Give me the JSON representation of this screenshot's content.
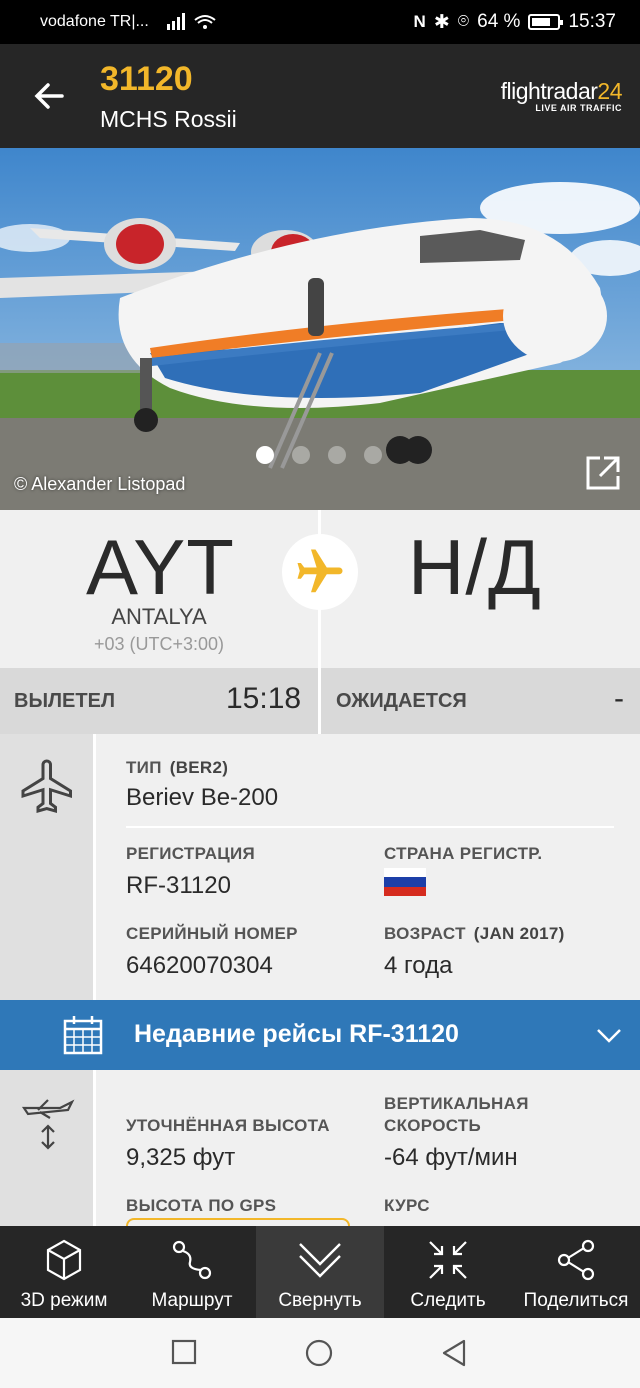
{
  "status_bar": {
    "carrier": "vodafone TR|...",
    "battery": "64 %",
    "time": "15:37"
  },
  "header": {
    "flight_number": "31120",
    "airline": "MCHS Rossii",
    "logo_brand": "flightradar",
    "logo_brand_num": "24",
    "logo_tagline": "LIVE AIR TRAFFIC"
  },
  "photo": {
    "credit": "© Alexander Listopad",
    "page_dots": 4,
    "active_dot": 0
  },
  "route": {
    "origin_code": "AYT",
    "origin_city": "ANTALYA",
    "origin_tz": "+03 (UTC+3:00)",
    "dest_code": "Н/Д"
  },
  "times": {
    "departed_label": "ВЫЛЕТЕЛ",
    "departed_time": "15:18",
    "expected_label": "ОЖИДАЕТСЯ",
    "expected_time": "-"
  },
  "aircraft": {
    "type_label": "ТИП",
    "type_code": "(BER2)",
    "type_value": "Beriev Be-200",
    "reg_label": "РЕГИСТРАЦИЯ",
    "reg_value": "RF-31120",
    "country_label": "СТРАНА РЕГИСТР.",
    "serial_label": "СЕРИЙНЫЙ НОМЕР",
    "serial_value": "64620070304",
    "age_label": "ВОЗРАСТ",
    "age_sub": "(JAN 2017)",
    "age_value": "4 года"
  },
  "recent": {
    "label": "Недавние рейсы RF-31120"
  },
  "altitude": {
    "calibrated_label": "УТОЧНЁННАЯ ВЫСОТА",
    "calibrated_value": "9,325 фут",
    "vspeed_label_1": "ВЕРТИКАЛЬНАЯ",
    "vspeed_label_2": "СКОРОСТЬ",
    "vspeed_value": "-64 фут/мин",
    "gps_label": "ВЫСОТА ПО GPS",
    "heading_label": "КУРС"
  },
  "bottom_nav": {
    "items": [
      {
        "label": "3D режим",
        "icon": "cube-icon"
      },
      {
        "label": "Маршрут",
        "icon": "route-icon"
      },
      {
        "label": "Свернуть",
        "icon": "collapse-icon"
      },
      {
        "label": "Следить",
        "icon": "follow-icon"
      },
      {
        "label": "Поделиться",
        "icon": "share-icon"
      }
    ],
    "active_index": 2
  },
  "colors": {
    "accent": "#f2b72a",
    "header_bg": "#262626",
    "recent_bar": "#2f78b8"
  }
}
